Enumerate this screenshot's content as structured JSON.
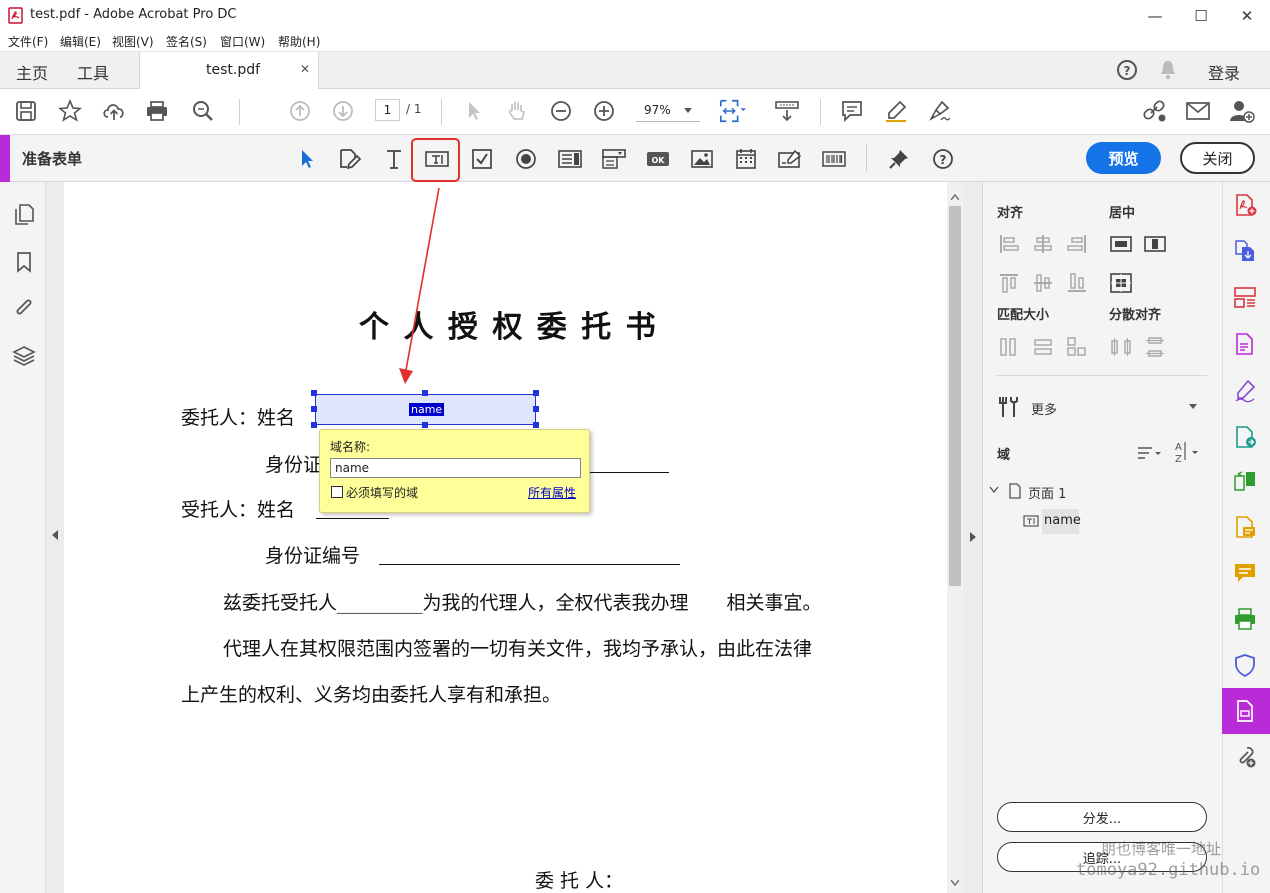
{
  "window": {
    "title": "test.pdf - Adobe Acrobat Pro DC",
    "min": "—",
    "max": "☐",
    "close": "✕"
  },
  "menu": [
    "文件(F)",
    "编辑(E)",
    "视图(V)",
    "签名(S)",
    "窗口(W)",
    "帮助(H)"
  ],
  "tabs": {
    "home": "主页",
    "tools": "工具",
    "doc": "test.pdf",
    "doc_close": "✕",
    "login": "登录"
  },
  "toolbar": {
    "page_current": "1",
    "page_total": "/ 1",
    "zoom": "97%"
  },
  "formbar": {
    "title": "准备表单",
    "preview": "预览",
    "close": "关闭"
  },
  "document": {
    "heading": "个 人 授 权 委 托 书",
    "line1": "委托人：姓名",
    "line2": "身份证",
    "line3": "受托人：姓名",
    "line4": "身份证编号",
    "line5": "兹委托受托人_________为我的代理人，全权代表我办理　　相关事宜。",
    "line6": "代理人在其权限范围内签署的一切有关文件，我均予承认，由此在法律",
    "line7": "上产生的权利、义务均由委托人享有和承担。",
    "signature": "委 托 人："
  },
  "field": {
    "name": "name"
  },
  "popup": {
    "label": "域名称:",
    "value": "name",
    "required": "必须填写的域",
    "all_props": "所有属性"
  },
  "right_panel": {
    "align": "对齐",
    "center": "居中",
    "match_size": "匹配大小",
    "distribute": "分散对齐",
    "more": "更多",
    "fields": "域",
    "page": "页面 1",
    "field_item": "name",
    "distribute_btn": "分发...",
    "track_btn": "追踪..."
  },
  "watermark": {
    "line1": "朋也博客唯一地址",
    "line2": "tomoya92.github.io"
  },
  "colors": {
    "accent": "#b92bd6",
    "primary": "#1473e6",
    "annotation": "#e0312b",
    "field_fill": "#dfe6fb",
    "popup_bg": "#ffff99"
  }
}
